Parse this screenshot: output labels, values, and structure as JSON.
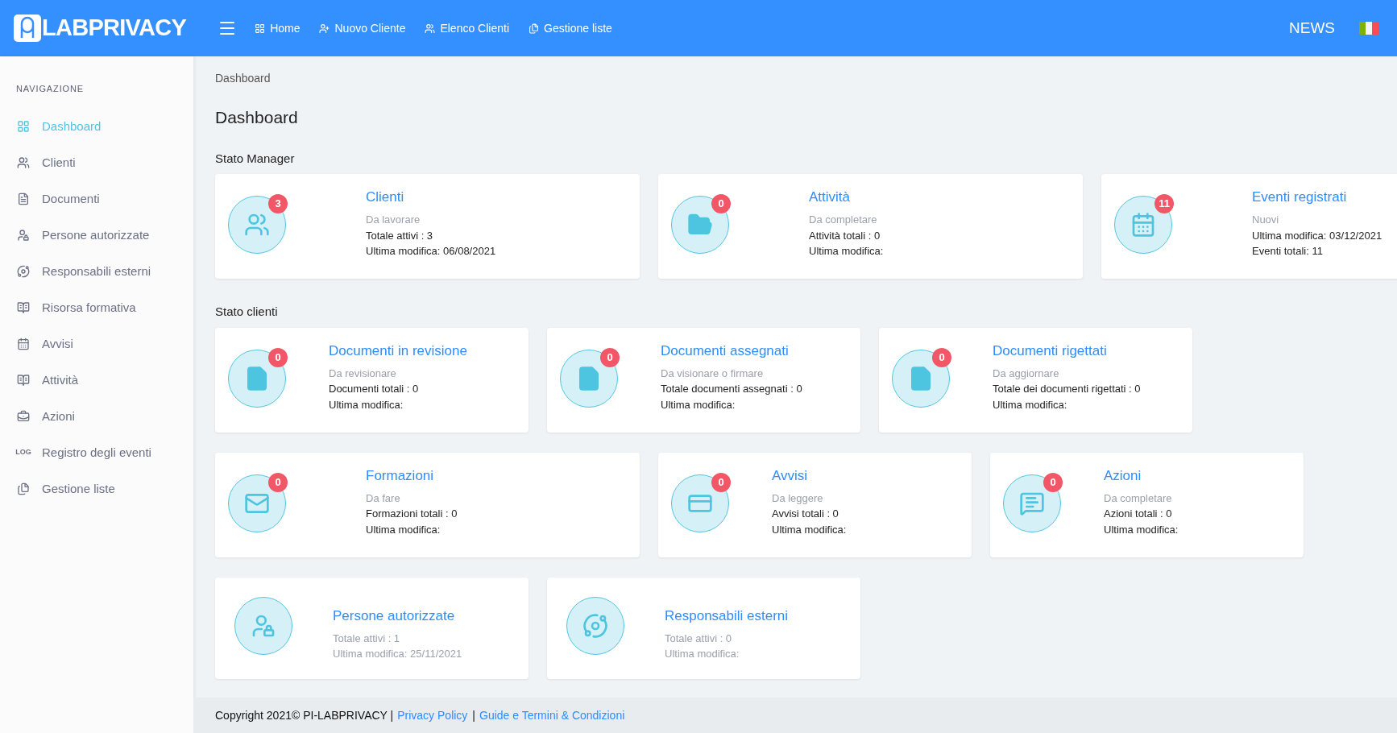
{
  "header": {
    "logo": "LABPRIVACY",
    "nav": [
      {
        "label": "Home"
      },
      {
        "label": "Nuovo Cliente"
      },
      {
        "label": "Elenco Clienti"
      },
      {
        "label": "Gestione liste"
      }
    ],
    "news": "NEWS"
  },
  "sidebar": {
    "heading": "NAVIGAZIONE",
    "items": [
      {
        "label": "Dashboard",
        "selected": true
      },
      {
        "label": "Clienti",
        "selected": false
      },
      {
        "label": "Documenti",
        "selected": false
      },
      {
        "label": "Persone autorizzate",
        "selected": false
      },
      {
        "label": "Responsabili esterni",
        "selected": false
      },
      {
        "label": "Risorsa formativa",
        "selected": false
      },
      {
        "label": "Avvisi",
        "selected": false
      },
      {
        "label": "Attività",
        "selected": false
      },
      {
        "label": "Azioni",
        "selected": false
      },
      {
        "label": "Registro degli eventi",
        "icon_text": "LOG",
        "selected": false
      },
      {
        "label": "Gestione liste",
        "selected": false
      }
    ]
  },
  "breadcrumb": "Dashboard",
  "title": "Dashboard",
  "sections": [
    {
      "title": "Stato Manager",
      "rows": [
        [
          {
            "title": "Clienti",
            "badge": "3",
            "lines": [
              {
                "text": "Da lavorare",
                "muted": true
              },
              {
                "text": "Totale attivi : 3",
                "muted": false
              },
              {
                "text": "Ultima modifica: 06/08/2021",
                "muted": false
              }
            ]
          },
          {
            "title": "Attività",
            "badge": "0",
            "lines": [
              {
                "text": "Da completare",
                "muted": true
              },
              {
                "text": "Attività totali : 0",
                "muted": false
              },
              {
                "text": "Ultima modifica:",
                "muted": false
              }
            ]
          },
          {
            "title": "Eventi registrati",
            "badge": "11",
            "lines": [
              {
                "text": "Nuovi",
                "muted": true
              },
              {
                "text": "Ultima modifica: 03/12/2021",
                "muted": false
              },
              {
                "text": "Eventi totali: 11",
                "muted": false
              }
            ]
          }
        ]
      ]
    },
    {
      "title": "Stato clienti",
      "rows": [
        [
          {
            "title": "Documenti in revisione",
            "badge": "0",
            "lines": [
              {
                "text": "Da revisionare",
                "muted": true
              },
              {
                "text": "Documenti totali : 0",
                "muted": false
              },
              {
                "text": "Ultima modifica:",
                "muted": false
              }
            ]
          },
          {
            "title": "Documenti assegnati",
            "badge": "0",
            "lines": [
              {
                "text": "Da visionare o firmare",
                "muted": true
              },
              {
                "text": "Totale documenti assegnati : 0",
                "muted": false
              },
              {
                "text": "Ultima modifica:",
                "muted": false
              }
            ]
          },
          {
            "title": "Documenti rigettati",
            "badge": "0",
            "lines": [
              {
                "text": "Da aggiornare",
                "muted": true
              },
              {
                "text": "Totale dei documenti rigettati : 0",
                "muted": false
              },
              {
                "text": "Ultima modifica:",
                "muted": false
              }
            ]
          }
        ],
        [
          {
            "title": "Formazioni",
            "badge": "0",
            "lines": [
              {
                "text": "Da fare",
                "muted": true
              },
              {
                "text": "Formazioni totali : 0",
                "muted": false
              },
              {
                "text": "Ultima modifica:",
                "muted": false
              }
            ]
          },
          {
            "title": "Avvisi",
            "badge": "0",
            "lines": [
              {
                "text": "Da leggere",
                "muted": true
              },
              {
                "text": "Avvisi totali : 0",
                "muted": false
              },
              {
                "text": "Ultima modifica:",
                "muted": false
              }
            ]
          },
          {
            "title": "Azioni",
            "badge": "0",
            "lines": [
              {
                "text": "Da completare",
                "muted": true
              },
              {
                "text": "Azioni totali : 0",
                "muted": false
              },
              {
                "text": "Ultima modifica:",
                "muted": false
              }
            ]
          }
        ],
        [
          {
            "title": "Persone autorizzate",
            "lines": [
              {
                "text": "Totale attivi : 1",
                "muted": true
              },
              {
                "text": "Ultima modifica: 25/11/2021",
                "muted": true
              }
            ]
          },
          {
            "title": "Responsabili esterni",
            "lines": [
              {
                "text": "Totale attivi : 0",
                "muted": true
              },
              {
                "text": "Ultima modifica:",
                "muted": true
              }
            ]
          }
        ]
      ]
    }
  ],
  "footer": {
    "copyright": "Copyright 2021© PI-LABPRIVACY |",
    "links": [
      {
        "label": "Privacy Policy",
        "separator": "|"
      },
      {
        "label": "Guide e Termini & Condizioni"
      }
    ]
  }
}
